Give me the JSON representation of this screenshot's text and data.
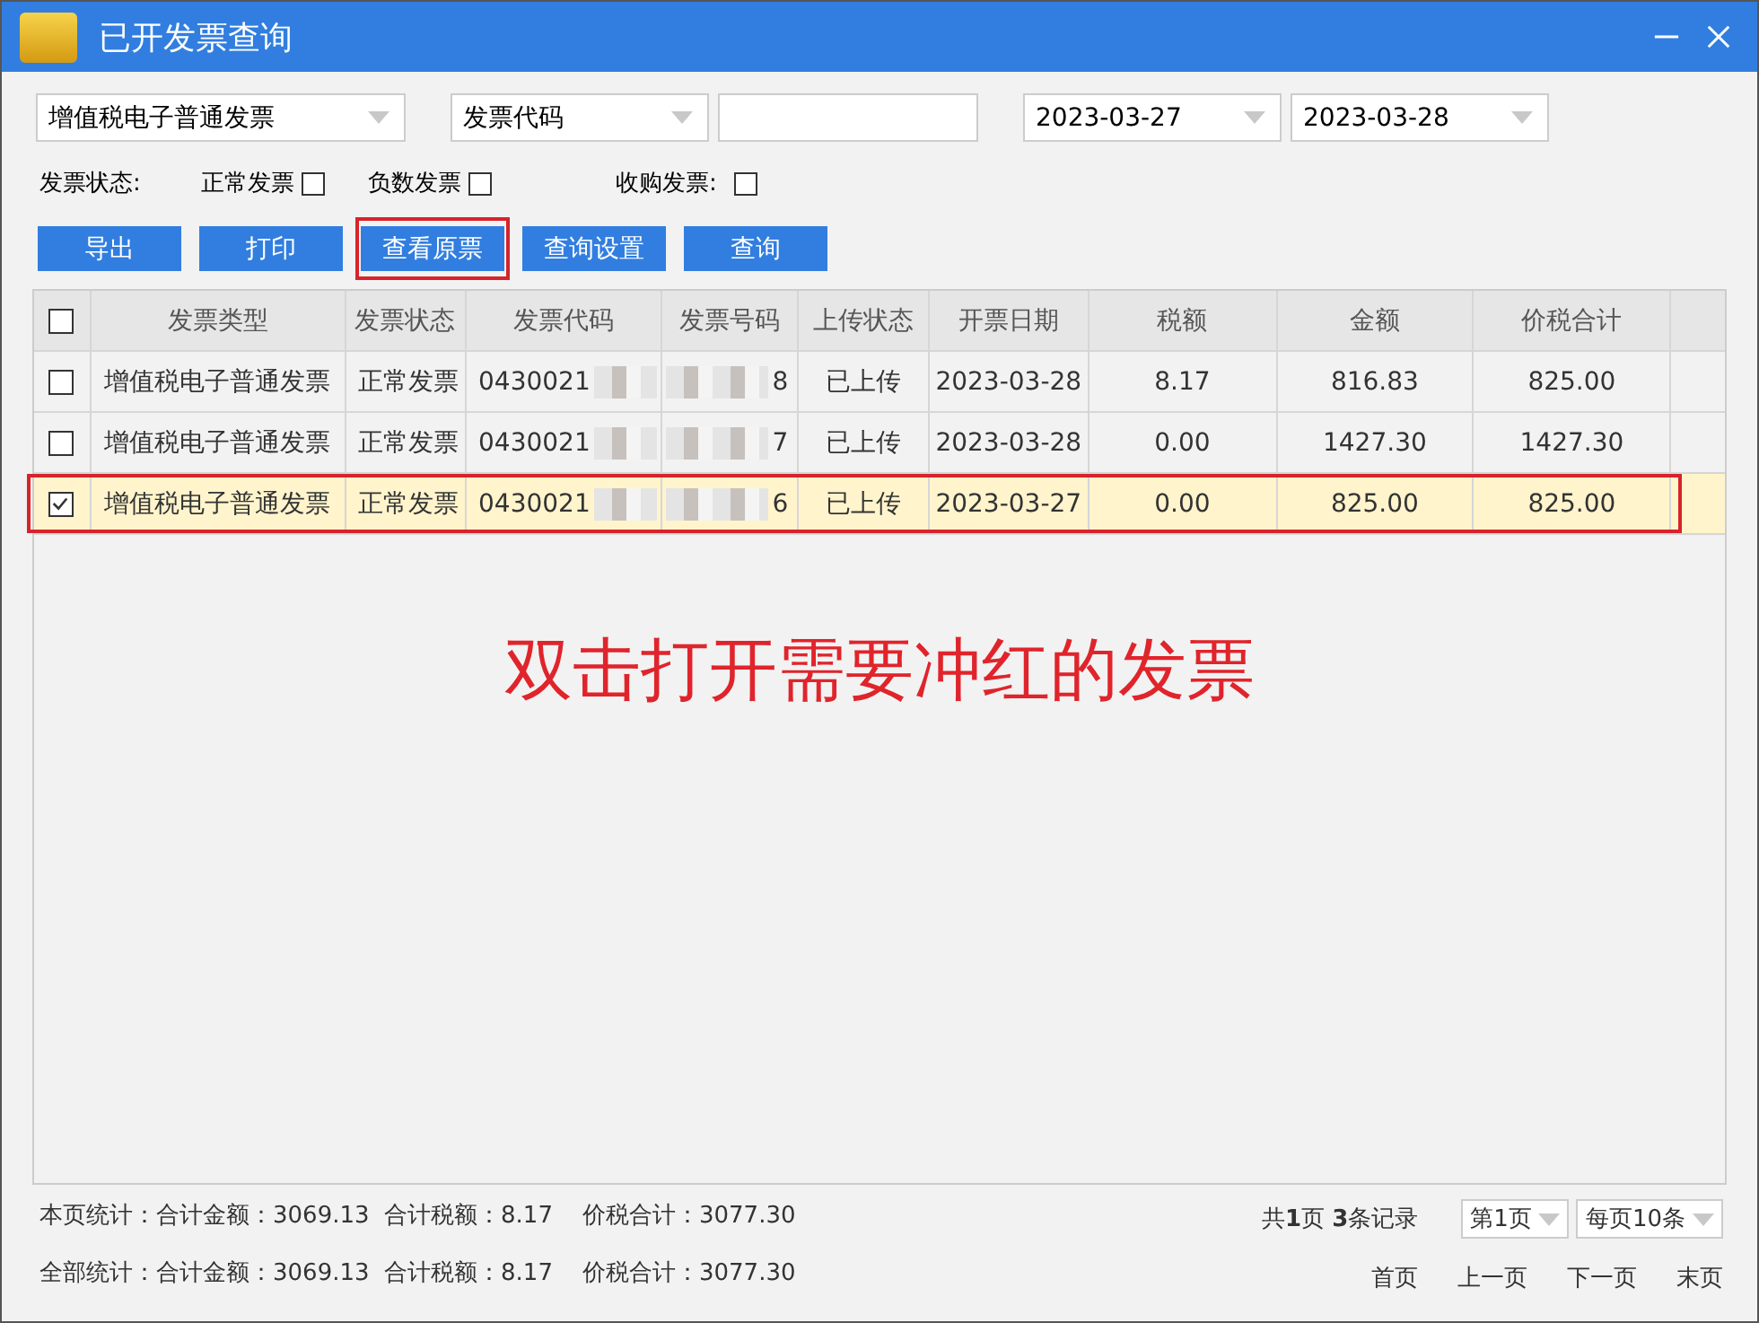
{
  "window": {
    "title": "已开发票查询"
  },
  "filters": {
    "invoice_type": "增值税电子普通发票",
    "search_field": "发票代码",
    "start_date": "2023-03-27",
    "end_date": "2023-03-28"
  },
  "status_filters": {
    "label": "发票状态:",
    "options": [
      {
        "label": "正常发票",
        "checked": false
      },
      {
        "label": "负数发票",
        "checked": false
      }
    ],
    "purchase": {
      "label": "收购发票:",
      "checked": false
    }
  },
  "buttons": [
    {
      "label": "导出",
      "highlighted": false
    },
    {
      "label": "打印",
      "highlighted": false
    },
    {
      "label": "查看原票",
      "highlighted": true
    },
    {
      "label": "查询设置",
      "highlighted": false
    },
    {
      "label": "查询",
      "highlighted": false
    }
  ],
  "table": {
    "header_checked": false,
    "columns": [
      "发票类型",
      "发票状态",
      "发票代码",
      "发票号码",
      "上传状态",
      "开票日期",
      "税额",
      "金额",
      "价税合计"
    ],
    "rows": [
      {
        "checked": false,
        "selected": false,
        "highlighted": false,
        "cells": [
          "增值税电子普通发票",
          "正常发票",
          "0430021",
          "8",
          "已上传",
          "2023-03-28",
          "8.17",
          "816.83",
          "825.00"
        ]
      },
      {
        "checked": false,
        "selected": false,
        "highlighted": false,
        "cells": [
          "增值税电子普通发票",
          "正常发票",
          "0430021",
          "7",
          "已上传",
          "2023-03-28",
          "0.00",
          "1427.30",
          "1427.30"
        ]
      },
      {
        "checked": true,
        "selected": true,
        "highlighted": true,
        "cells": [
          "增值税电子普通发票",
          "正常发票",
          "0430021",
          "6",
          "已上传",
          "2023-03-27",
          "0.00",
          "825.00",
          "825.00"
        ]
      }
    ]
  },
  "annotation": "双击打开需要冲红的发票",
  "footer": {
    "page_stats": "本页统计：合计金额：3069.13  合计税额：8.17    价税合计：3077.30",
    "all_stats": "全部统计：合计金额：3069.13  合计税额：8.17    价税合计：3077.30",
    "records": "共**1**页 **3**条记录",
    "page_select": "第1页",
    "page_size": "每页10条",
    "nav": [
      "首页",
      "上一页",
      "下一页",
      "末页"
    ]
  }
}
